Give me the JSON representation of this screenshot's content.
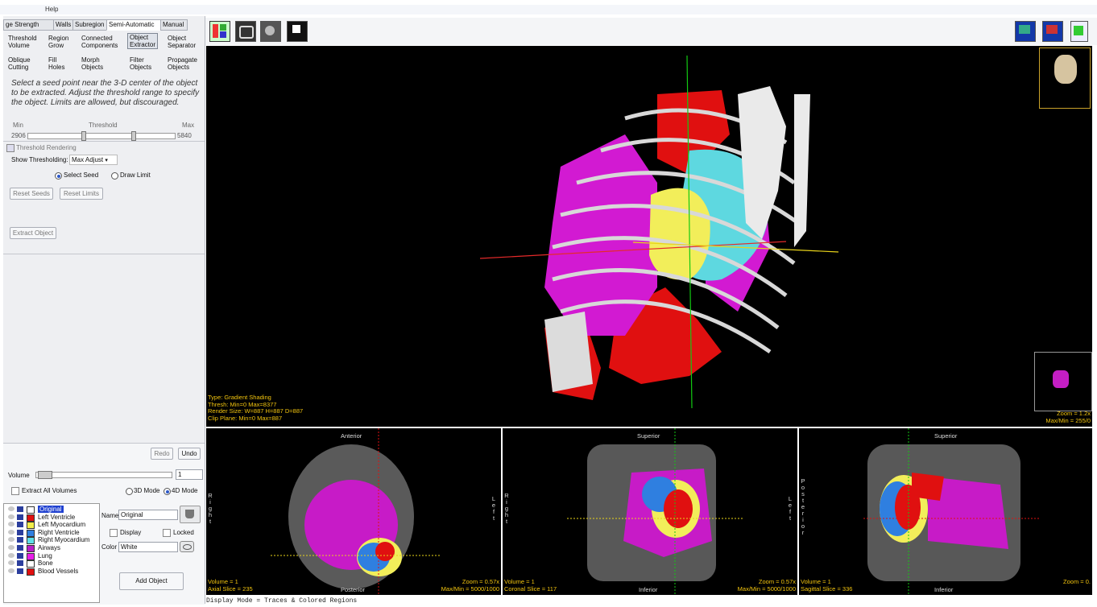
{
  "menu": {
    "help": "Help"
  },
  "tabs": [
    "ge Strength",
    "Walls",
    "Subregion",
    "Semi-Automatic",
    "Manual"
  ],
  "tools_row1": [
    {
      "l1": "Threshold",
      "l2": "Volume"
    },
    {
      "l1": "Region",
      "l2": "Grow"
    },
    {
      "l1": "Connected",
      "l2": "Components"
    },
    {
      "l1": "Object",
      "l2": "Extractor"
    },
    {
      "l1": "Object",
      "l2": "Separator"
    }
  ],
  "tools_row2": [
    {
      "l1": "Oblique",
      "l2": "Cutting"
    },
    {
      "l1": "Fill",
      "l2": "Holes"
    },
    {
      "l1": "Morph",
      "l2": "Objects"
    },
    {
      "l1": "Filter",
      "l2": "Objects"
    },
    {
      "l1": "Propagate",
      "l2": "Objects"
    }
  ],
  "instructions": "Select a seed point near the 3-D center of the object to be extracted. Adjust the threshold range to specify the object. Limits are allowed, but discouraged.",
  "threshold": {
    "min_label": "Min",
    "label": "Threshold",
    "max_label": "Max",
    "min_value": "2906",
    "max_value": "5840"
  },
  "threshold_rendering": "Threshold Rendering",
  "show_thresholding": {
    "label": "Show Thresholding:",
    "value": "Max Adjust"
  },
  "seed_mode": {
    "select_seed": "Select Seed",
    "draw_limit": "Draw Limit"
  },
  "buttons": {
    "reset_seeds": "Reset Seeds",
    "reset_limits": "Reset Limits",
    "extract_object": "Extract Object",
    "redo": "Redo",
    "undo": "Undo",
    "add_object": "Add Object"
  },
  "volume": {
    "label": "Volume",
    "value": "1",
    "extract_all": "Extract All Volumes",
    "mode3d": "3D Mode",
    "mode4d": "4D Mode"
  },
  "objects": [
    {
      "name": "Original",
      "color": "#ffffff",
      "selected": true
    },
    {
      "name": "Left Ventricle",
      "color": "#e01010"
    },
    {
      "name": "Left Myocardium",
      "color": "#f2ee4a"
    },
    {
      "name": "Right Ventricle",
      "color": "#2f7fe0"
    },
    {
      "name": "Right Myocardium",
      "color": "#5ee0e8"
    },
    {
      "name": "Airways",
      "color": "#b81ec8"
    },
    {
      "name": "Lung",
      "color": "#e81ee8"
    },
    {
      "name": "Bone",
      "color": "#ffffff"
    },
    {
      "name": "Blood Vessels",
      "color": "#e01010"
    }
  ],
  "object_props": {
    "name_label": "Name",
    "name_value": "Original",
    "display": "Display",
    "locked": "Locked",
    "color_label": "Color",
    "color_value": "White"
  },
  "view3d": {
    "info": [
      "Type: Gradient Shading",
      "Thresh: Min=0 Max=8377",
      "Render Size: W=887 H=887 D=887",
      "Clip Plane: Min=0 Max=887"
    ],
    "zoom": "Zoom = 1.2x",
    "maxmin": "Max/Min = 255/0"
  },
  "axial": {
    "top": "Anterior",
    "bottom": "Posterior",
    "left": "Right",
    "right": "Left",
    "volume": "Volume = 1",
    "slice": "Axial Slice = 235",
    "zoom": "Zoom = 0.57x",
    "maxmin": "Max/Min = 5000/1000"
  },
  "coronal": {
    "top": "Superior",
    "bottom": "Inferior",
    "left": "Right",
    "right": "Left",
    "volume": "Volume = 1",
    "slice": "Coronal Slice = 117",
    "zoom": "Zoom = 0.57x",
    "maxmin": "Max/Min = 5000/1000"
  },
  "sagittal": {
    "top": "Superior",
    "bottom": "Inferior",
    "left": "Posterior",
    "volume": "Volume = 1",
    "slice": "Sagittal Slice = 336",
    "zoom": "Zoom = 0.",
    "maxmin": ""
  },
  "status": "Display Mode = Traces & Colored Regions"
}
